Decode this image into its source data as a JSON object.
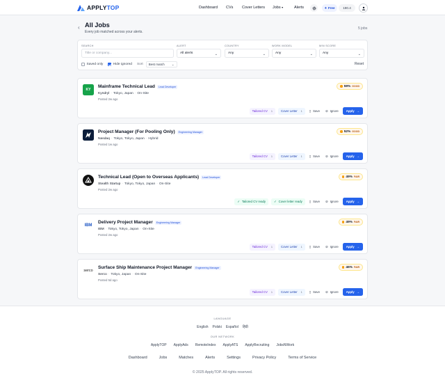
{
  "brand": {
    "name_left": "APPLY",
    "name_right": "TOP",
    "accent": "#2563eb"
  },
  "nav": {
    "dashboard": "Dashboard",
    "cvs": "CVs",
    "cover_letters": "Cover Letters",
    "jobs": "Jobs",
    "alerts": "Alerts",
    "plan": "Free",
    "credits": "190.4",
    "icons": [
      "gear-icon",
      "user-icon",
      "chevron-down-icon",
      "sparkle-icon"
    ]
  },
  "page": {
    "title": "All Jobs",
    "subtitle": "Every job matched across your alerts.",
    "count": "5 jobs"
  },
  "filters": {
    "search_label": "SEARCH",
    "search_placeholder": "Title or company...",
    "alert_label": "ALERT",
    "alert_value": "All alerts",
    "country_label": "COUNTRY",
    "country_value": "Any",
    "work_model_label": "WORK MODEL",
    "work_model_value": "Any",
    "min_score_label": "MIN SCORE",
    "min_score_value": "Any",
    "saved_only": "Saved only",
    "hide_ignored": "Hide ignored",
    "sort_label": "Sort",
    "sort_value": "Best match",
    "reset": "Reset"
  },
  "actions": {
    "tailored_cv": "Tailored CV",
    "cover_letter": "Cover Letter",
    "tailored_cv_ready": "Tailored CV ready",
    "cover_letter_ready": "Cover letter ready",
    "save": "Save",
    "ignore": "Ignore",
    "apply": "Apply"
  },
  "jobs": [
    {
      "title": "Mainframe Technical Lead",
      "tag": "Lead Developer",
      "company": "Kyndryl",
      "location": "Tokyo, Japan",
      "work_model": "On-Site",
      "posted": "Posted 2w ago",
      "score": "59%",
      "grade": "GOOD",
      "cv_count": "1",
      "cl_count": "1",
      "logo": "KY"
    },
    {
      "title": "Project Manager (For Pooling Only)",
      "tag": "Engineering Manager",
      "company": "Nasdaq",
      "location": "Tokyo, Tokyo, Japan",
      "work_model": "Hybrid",
      "posted": "Posted 1w ago",
      "score": "52%",
      "grade": "GOOD",
      "cv_count": "1",
      "cl_count": "1",
      "logo": "N"
    },
    {
      "title": "Technical Lead (Open to Overseas Applicants)",
      "tag": "Lead Developer",
      "company": "Stealth Startup",
      "location": "Tokyo, Tokyo, Japan",
      "work_model": "On-Site",
      "posted": "Posted 2w ago",
      "score": "49%",
      "grade": "FAIR",
      "cv_count": "",
      "cl_count": "",
      "logo": ""
    },
    {
      "title": "Delivery Project Manager",
      "tag": "Engineering Manager",
      "company": "IBM",
      "location": "Tokyo, Tokyo, Japan",
      "work_model": "On-Site",
      "posted": "Posted 2w ago",
      "score": "49%",
      "grade": "FAIR",
      "cv_count": "1",
      "cl_count": "1",
      "logo": "IBM"
    },
    {
      "title": "Surface Ship Maintenance Project Manager",
      "tag": "Engineering Manager",
      "company": "Serco",
      "location": "Tokyo, Japan",
      "work_model": "On-Site",
      "posted": "Posted 5d ago",
      "score": "46%",
      "grade": "FAIR",
      "cv_count": "1",
      "cl_count": "1",
      "logo": "serco"
    }
  ],
  "footer": {
    "language_label": "LANGUAGE",
    "languages": [
      "English",
      "Polski",
      "Español",
      "हिंदी"
    ],
    "network_label": "OUR NETWORK",
    "network": [
      "ApplyTOP",
      "ApplyAds",
      "RemoteIndex",
      "ApplyATS",
      "ApplyRecruiting",
      "JobsNWork"
    ],
    "links": [
      "Dashboard",
      "Jobs",
      "Matches",
      "Alerts",
      "Settings",
      "Privacy Policy",
      "Terms of Service"
    ],
    "copyright": "© 2025 ApplyTOP. All rights reserved."
  }
}
